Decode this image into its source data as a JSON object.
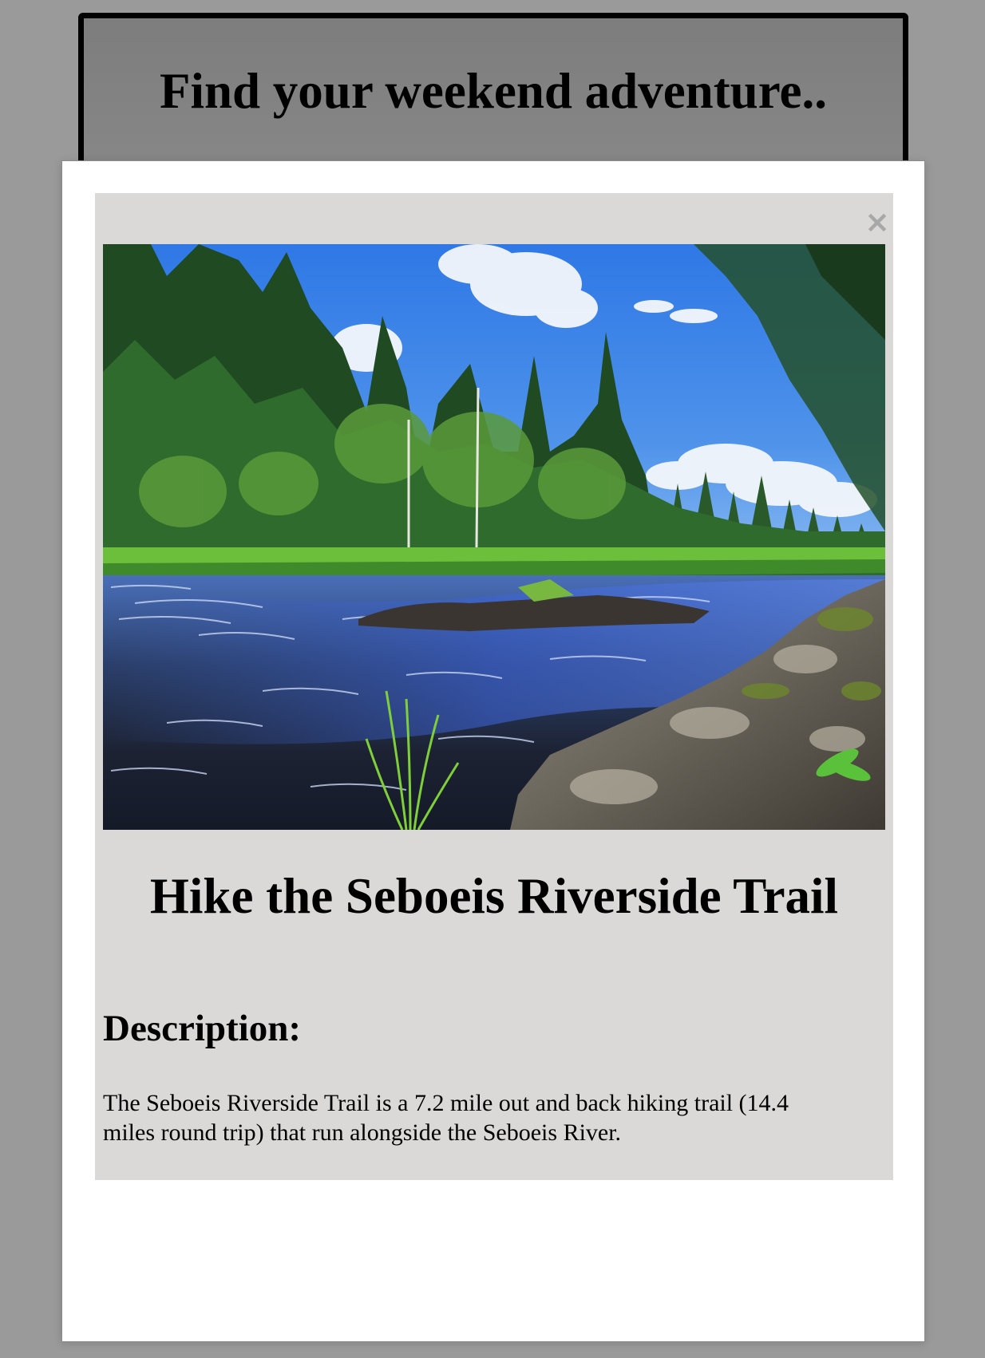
{
  "header": {
    "title": "Find your weekend adventure.."
  },
  "modal": {
    "close_label": "×",
    "image_alt": "Seboeis River with forest and rocks",
    "title": "Hike the Seboeis Riverside Trail",
    "description_heading": "Description:",
    "description_text": "The Seboeis Riverside Trail is a 7.2 mile out and back hiking trail (14.4 miles round trip) that run alongside the Seboeis River."
  },
  "colors": {
    "backdrop": "#9a9a9a",
    "modal_bg": "#ffffff",
    "content_bg": "#dad9d8",
    "close_icon": "#a8a8a8"
  }
}
